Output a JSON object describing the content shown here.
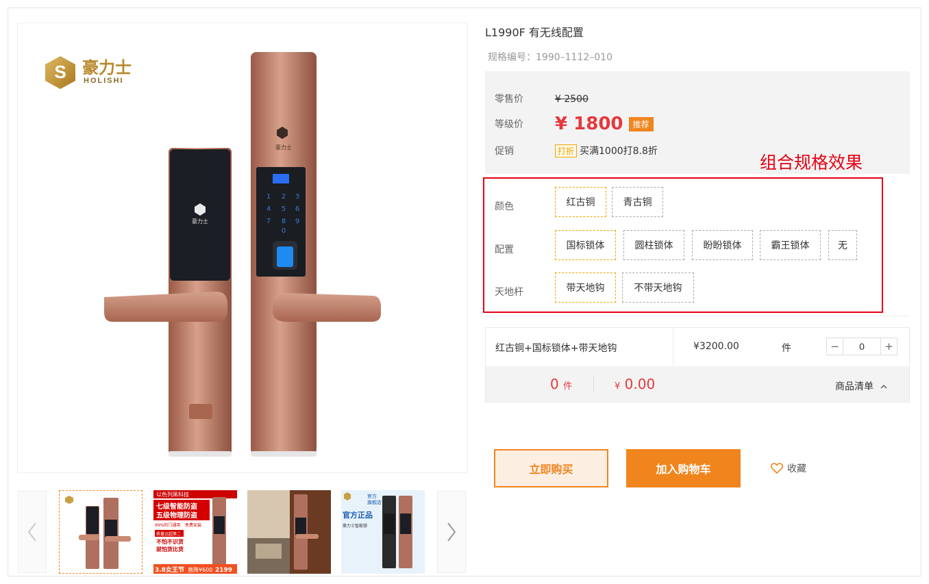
{
  "product": {
    "title": "L1990F 有无线配置",
    "spec_code": "规格编号：1990–1112–010"
  },
  "brand": {
    "logo_cn": "豪力士",
    "logo_en": "HOLISHI"
  },
  "price": {
    "retail_label": "零售价",
    "retail_value": "¥ 2500",
    "level_label": "等级价",
    "level_value": "¥ 1800",
    "recommend_badge": "推荐",
    "promo_label": "促销",
    "promo_badge": "打折",
    "promo_text": "买满1000打8.8折"
  },
  "annotation": "组合规格效果",
  "specs": {
    "color": {
      "label": "颜色",
      "options": [
        "红古铜",
        "青古铜"
      ],
      "selected": "红古铜"
    },
    "config": {
      "label": "配置",
      "options": [
        "国标锁体",
        "圆柱锁体",
        "盼盼锁体",
        "霸王锁体",
        "无"
      ],
      "selected": "国标锁体"
    },
    "rod": {
      "label": "天地杆",
      "options": [
        "带天地钩",
        "不带天地钩"
      ],
      "selected": "带天地钩"
    }
  },
  "combo": {
    "name": "红古铜+国标锁体+带天地钩",
    "price": "¥3200.00",
    "unit": "件",
    "quantity": "0",
    "minus": "−",
    "plus": "+"
  },
  "summary": {
    "count": "0",
    "count_unit": "件",
    "currency": "¥",
    "total": "0.00",
    "list_label": "商品清单"
  },
  "actions": {
    "buy_now": "立即购买",
    "add_to_cart": "加入购物车",
    "favorite": "收藏"
  },
  "thumbnails": [
    {
      "texts": []
    },
    {
      "texts": [
        "以色列黑科技",
        "七级智能防盗",
        "五级物理防盗",
        "99%的门通用",
        "免费安装",
        "质量远超第二",
        "不怕不识货",
        "就怕货比货",
        "3.8女王节",
        "直降¥600",
        "2199"
      ]
    },
    {
      "texts": []
    },
    {
      "texts": [
        "官方",
        "旗舰店",
        "官方正品",
        "豪力士智能锁"
      ]
    }
  ],
  "colors": {
    "accent": "#f0851e",
    "price_red": "#e4393c",
    "annotation_red": "#e60012",
    "bronze": "#c98a72"
  }
}
